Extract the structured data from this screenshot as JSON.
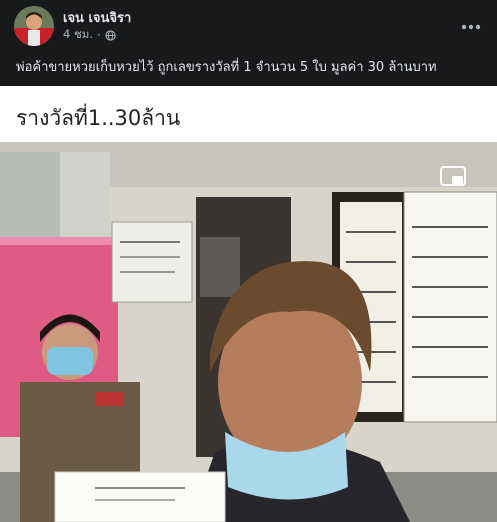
{
  "post": {
    "author": "เจน เจนจิรา",
    "time": "4 ชม.",
    "separator": "·",
    "text": "พ่อค้าขายหวยเก็บหวยไว้ ถูกเลขรางวัลที่ 1 จำนวน 5 ใบ มูลค่า 30 ล้านบาท"
  },
  "video": {
    "title": "รางวัลที่1..30ล้าน"
  },
  "icons": {
    "avatar": "avatar",
    "privacy": "globe-icon",
    "more": "more-horizontal-icon",
    "pip": "picture-in-picture-icon"
  },
  "colors": {
    "background": "#18191a",
    "text_primary": "#e4e6eb",
    "text_secondary": "#b0b3b8",
    "media_background": "#ffffff"
  }
}
